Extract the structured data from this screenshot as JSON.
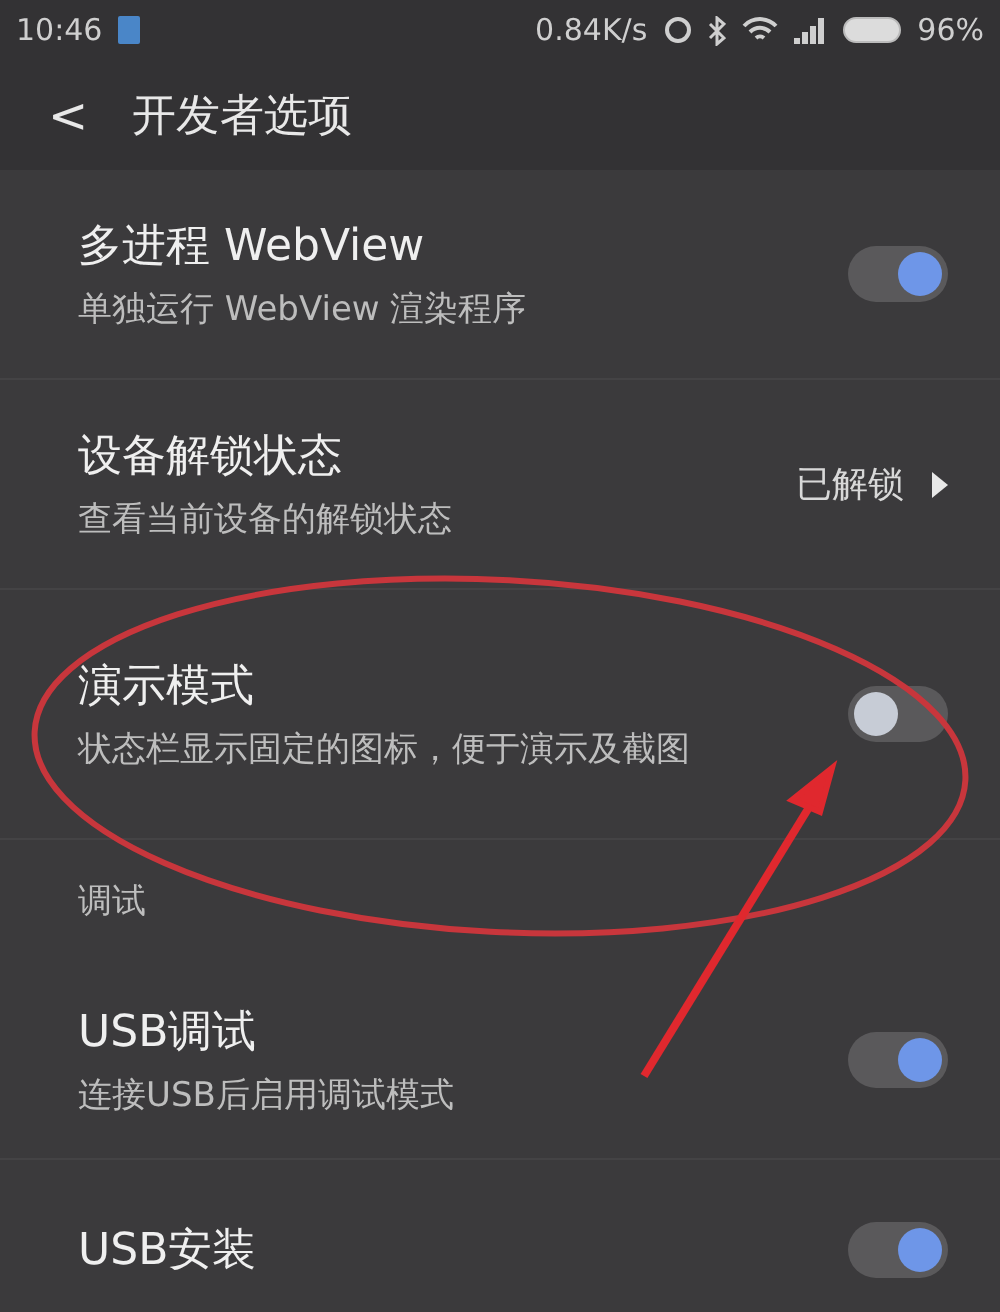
{
  "status_bar": {
    "time": "10:46",
    "speed": "0.84K/s",
    "battery": "96%"
  },
  "toolbar": {
    "back": "<",
    "title": "开发者选项"
  },
  "items": [
    {
      "kind": "toggle",
      "title": "多进程 WebView",
      "subtitle": "单独运行 WebView 渲染程序",
      "on": true
    },
    {
      "kind": "value",
      "title": "设备解锁状态",
      "subtitle": "查看当前设备的解锁状态",
      "value": "已解锁"
    },
    {
      "kind": "toggle",
      "title": "演示模式",
      "subtitle": "状态栏显示固定的图标，便于演示及截图",
      "on": false
    },
    {
      "kind": "section",
      "title": "调试"
    },
    {
      "kind": "toggle",
      "title": "USB调试",
      "subtitle": "连接USB后启用调试模式",
      "on": true
    },
    {
      "kind": "toggle",
      "title": "USB安装",
      "on": true
    }
  ]
}
